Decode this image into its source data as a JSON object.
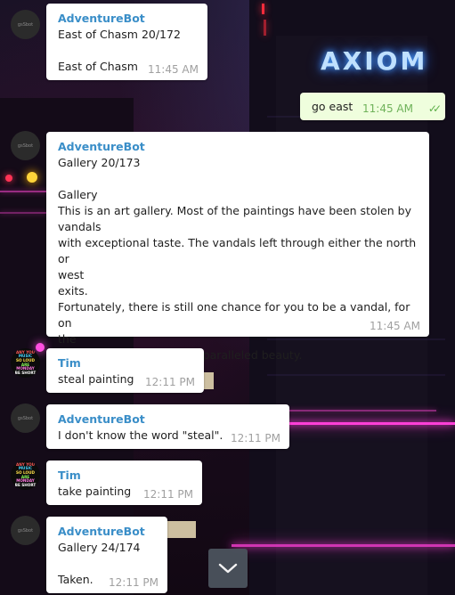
{
  "messages": [
    {
      "sender": "AdventureBot",
      "avatar": "gsSbot",
      "text": "East of Chasm 20/172\n\nEast of Chasm",
      "time": "11:45 AM"
    },
    {
      "outgoing": true,
      "text": "go east",
      "time": "11:45 AM",
      "status_icon": "double-check-icon"
    },
    {
      "sender": "AdventureBot",
      "avatar": "gsSbot",
      "text": "Gallery 20/173\n\nGallery\nThis is an art gallery. Most of the paintings have been stolen by\nvandals\nwith exceptional taste. The vandals left through either the north or\nwest\nexits.\nFortunately, there is still one chance for you to be a vandal, for on\nthe\nfar wall is a painting of unparalleled beauty.",
      "time": "11:45 AM"
    },
    {
      "sender": "Tim",
      "avatar_lines": [
        "ANY YOU",
        "MUSIC",
        "SO LOUD",
        "ARE",
        "MONDAY",
        "BE SHORT"
      ],
      "text": "steal painting",
      "time": "12:11 PM"
    },
    {
      "sender": "AdventureBot",
      "avatar": "gsSbot",
      "text": "I don't know the word \"steal\".",
      "time": "12:11 PM"
    },
    {
      "sender": "Tim",
      "avatar_lines": [
        "ANY YOU",
        "MUSIC",
        "SO LOUD",
        "ARE",
        "MONDAY",
        "BE SHORT"
      ],
      "text": "take painting",
      "time": "12:11 PM"
    },
    {
      "sender": "AdventureBot",
      "avatar": "gsSbot",
      "text": "Gallery 24/174\n\nTaken.",
      "time": "12:11 PM"
    }
  ],
  "background": {
    "sign_text": "AXIOM",
    "neon_color": "#ff3fd8",
    "sign_color": "#bfe0ff"
  },
  "scroll_down_icon": "chevron-down-icon",
  "colors": {
    "sender": "#3a8ec8",
    "incoming_bubble": "#ffffff",
    "outgoing_bubble": "#effedd",
    "read_ticks": "#5fb04a"
  }
}
